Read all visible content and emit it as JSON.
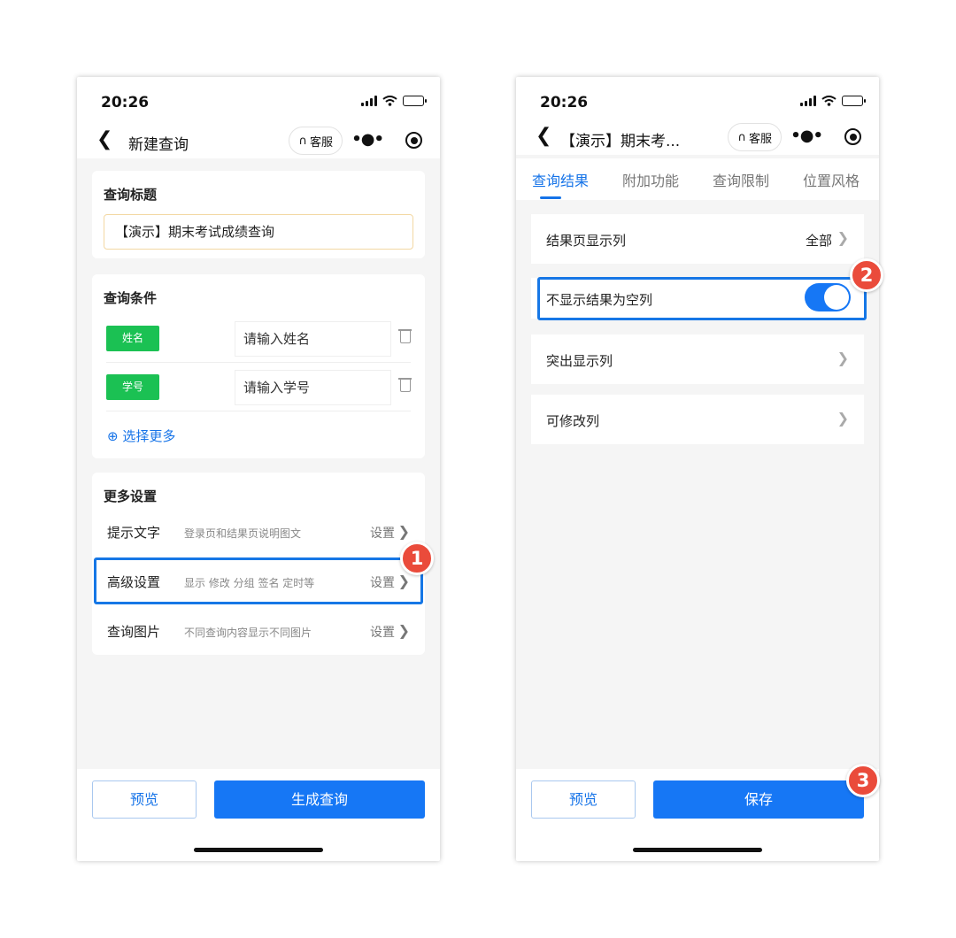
{
  "status": {
    "time": "20:26"
  },
  "left": {
    "nav_title": "新建查询",
    "kefu_label": "客服",
    "query_title_label": "查询标题",
    "query_title_value": "【演示】期末考试成绩查询",
    "conditions_label": "查询条件",
    "conditions": [
      {
        "tag": "姓名",
        "placeholder": "请输入姓名"
      },
      {
        "tag": "学号",
        "placeholder": "请输入学号"
      }
    ],
    "select_more": "⊕ 选择更多",
    "more_settings_label": "更多设置",
    "settings": [
      {
        "label": "提示文字",
        "desc": "登录页和结果页说明图文",
        "action": "设置"
      },
      {
        "label": "高级设置",
        "desc": "显示 修改 分组 签名 定时等",
        "action": "设置"
      },
      {
        "label": "查询图片",
        "desc": "不同查询内容显示不同图片",
        "action": "设置"
      }
    ],
    "preview_label": "预览",
    "generate_label": "生成查询",
    "badge": "1"
  },
  "right": {
    "nav_title": "【演示】期末考...",
    "kefu_label": "客服",
    "tabs": [
      "查询结果",
      "附加功能",
      "查询限制",
      "位置风格"
    ],
    "active_tab": 0,
    "rows": {
      "display_columns": {
        "label": "结果页显示列",
        "value": "全部"
      },
      "hide_empty": {
        "label": "不显示结果为空列",
        "enabled": true
      },
      "highlight_columns": {
        "label": "突出显示列"
      },
      "editable_columns": {
        "label": "可修改列"
      }
    },
    "preview_label": "预览",
    "save_label": "保存",
    "badge_toggle": "2",
    "badge_save": "3"
  },
  "colors": {
    "accent": "#1677f5",
    "tag_green": "#1bc153",
    "badge_red": "#ea4b3b"
  }
}
